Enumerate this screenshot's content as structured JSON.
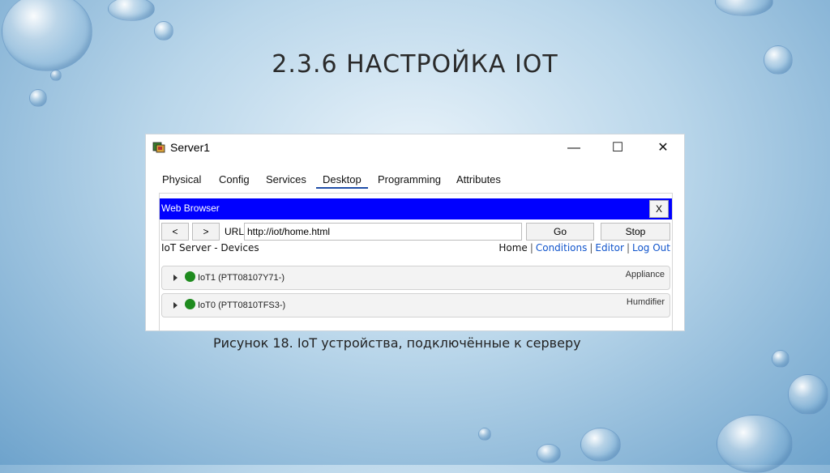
{
  "slide": {
    "title": "2.3.6 НАСТРОЙКА IOT",
    "caption": "Рисунок 18. IoT устройства, подключённые к серверу"
  },
  "window": {
    "title": "Server1",
    "controls": {
      "minimize": "—",
      "maximize": "☐",
      "close": "✕"
    },
    "tabs": [
      "Physical",
      "Config",
      "Services",
      "Desktop",
      "Programming",
      "Attributes"
    ],
    "active_tab": "Desktop"
  },
  "browser": {
    "title": "Web Browser",
    "close_label": "X",
    "back_label": "<",
    "forward_label": ">",
    "url_label": "URL",
    "url_value": "http://iot/home.html",
    "go_label": "Go",
    "stop_label": "Stop"
  },
  "page": {
    "heading": "IoT Server - Devices",
    "nav": [
      "Home",
      "Conditions",
      "Editor",
      "Log Out"
    ],
    "devices": [
      {
        "name": "IoT1 (PTT08107Y71-)",
        "type": "Appliance",
        "status_color": "#1e8b1e"
      },
      {
        "name": "IoT0 (PTT0810TFS3-)",
        "type": "Humdifier",
        "status_color": "#1e8b1e"
      }
    ]
  }
}
